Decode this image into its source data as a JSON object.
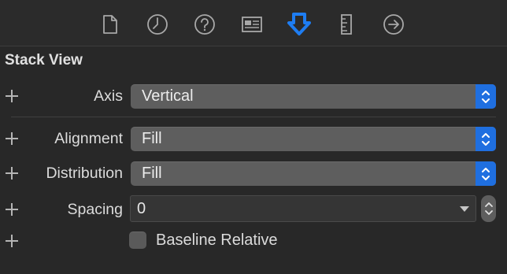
{
  "toolbar": {
    "icons": [
      {
        "name": "file-inspector-icon"
      },
      {
        "name": "history-inspector-icon"
      },
      {
        "name": "quick-help-icon"
      },
      {
        "name": "identity-inspector-icon"
      },
      {
        "name": "attributes-inspector-icon",
        "selected": true,
        "color": "#1e7df2"
      },
      {
        "name": "size-inspector-icon"
      },
      {
        "name": "connections-inspector-icon"
      }
    ]
  },
  "section": {
    "title": "Stack View"
  },
  "axis": {
    "label": "Axis",
    "value": "Vertical"
  },
  "alignment": {
    "label": "Alignment",
    "value": "Fill"
  },
  "distribution": {
    "label": "Distribution",
    "value": "Fill"
  },
  "spacing": {
    "label": "Spacing",
    "value": "0"
  },
  "baseline": {
    "label": "Baseline Relative",
    "checked": false
  },
  "colors": {
    "accent": "#1e7df2",
    "background": "#282828",
    "popup": "#5e5e5e"
  }
}
